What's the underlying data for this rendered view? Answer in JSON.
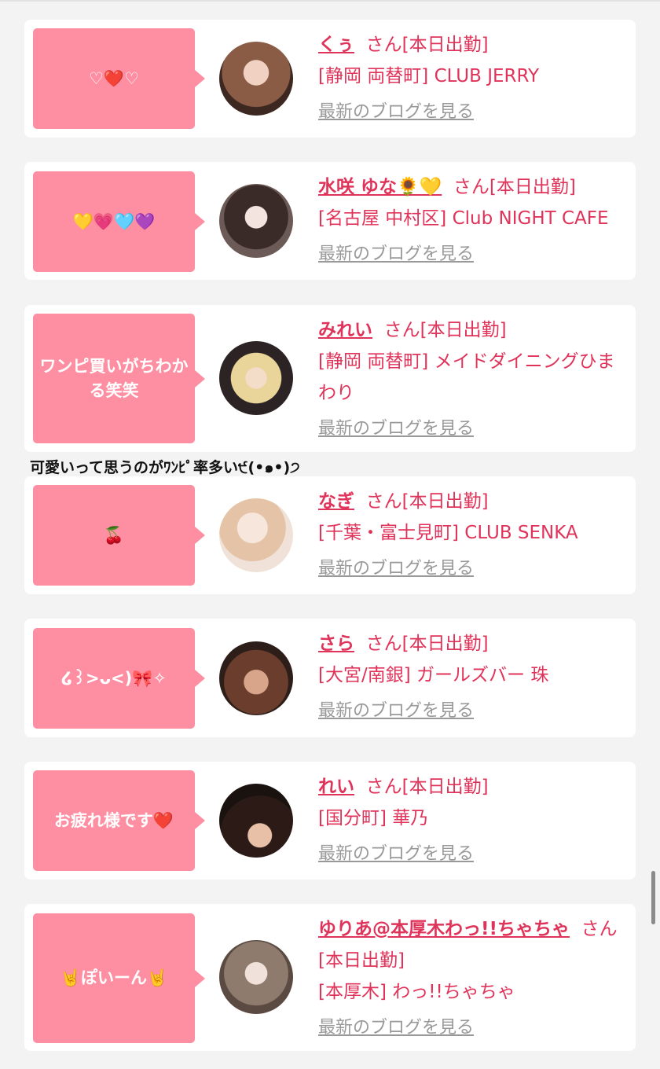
{
  "entries": [
    {
      "comment": "♡❤️♡",
      "name": "くぅ",
      "suffix": "さん[本日出勤]",
      "shop": "[静岡 両替町] CLUB JERRY",
      "blog_link": "最新のブログを見る"
    },
    {
      "comment": "💛💗🩵💜",
      "name": "水咲 ゆな🌻💛",
      "suffix": "さん[本日出勤]",
      "shop": "[名古屋 中村区] Club NIGHT CAFE",
      "blog_link": "最新のブログを見る"
    },
    {
      "comment": "ワンピ買いがちわかる笑笑",
      "name": "みれい",
      "suffix": "さん[本日出勤]",
      "shop": "[静岡 両替町] メイドダイニングひまわり",
      "blog_link": "最新のブログを見る"
    },
    {
      "comment": "🍒",
      "name": "なぎ",
      "suffix": "さん[本日出勤]",
      "shop": "[千葉・富士見町] CLUB SENKA",
      "blog_link": "最新のブログを見る"
    },
    {
      "comment": "໒꒱>ᴗ<)🎀✧",
      "name": "さら",
      "suffix": "さん[本日出勤]",
      "shop": "[大宮/南銀] ガールズバー 珠",
      "blog_link": "最新のブログを見る"
    },
    {
      "comment": "お疲れ様です❤️",
      "name": "れい",
      "suffix": "さん[本日出勤]",
      "shop": "[国分町] 華乃",
      "blog_link": "最新のブログを見る"
    },
    {
      "comment": "🤘ぽいーん🤘",
      "name": "ゆりあ@本厚木わっ!!ちゃちゃ",
      "suffix": "さん[本日出勤]",
      "shop": "[本厚木] わっ!!ちゃちゃ",
      "blog_link": "最新のブログを見る"
    }
  ],
  "between_text": "可愛いって思うのがﾜﾝﾋﾟ率多い੯(•๑•)੭",
  "colors": {
    "accent": "#e0335a",
    "bubble": "#fe8fa2",
    "link_gray": "#999999"
  }
}
